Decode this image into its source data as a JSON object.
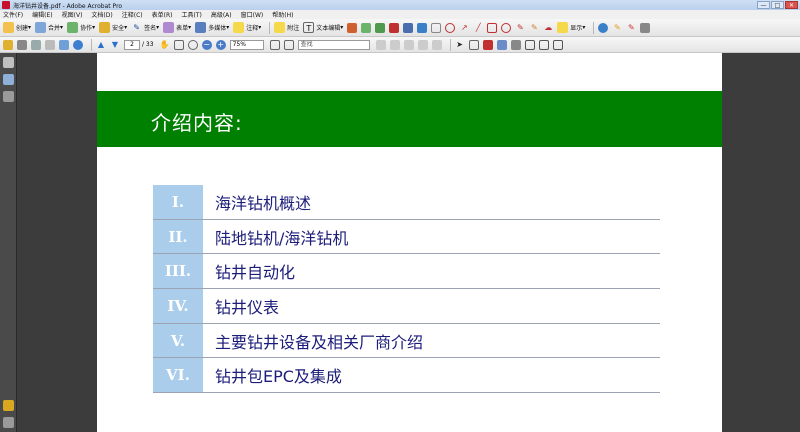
{
  "window": {
    "title": "海洋钻井设备.pdf - Adobe Acrobat Pro",
    "min": "—",
    "max": "□",
    "close": "✕"
  },
  "menu": [
    "文件(F)",
    "编辑(E)",
    "视图(V)",
    "文档(D)",
    "注释(C)",
    "表单(R)",
    "工具(T)",
    "高级(A)",
    "窗口(W)",
    "帮助(H)"
  ],
  "toolbar1": {
    "create": "创建",
    "combine": "合并",
    "collaborate": "协作",
    "secure": "安全",
    "sign": "签名",
    "forms": "表单",
    "multimedia": "多媒体",
    "comment": "注释",
    "note": "附注",
    "text_edit": "文本编辑",
    "show": "显示"
  },
  "toolbar2": {
    "page_current": "2",
    "page_total": "/ 33",
    "zoom": "75%",
    "find_placeholder": "查找"
  },
  "slide": {
    "banner_title": "介绍内容:",
    "items": [
      {
        "num": "I.",
        "text": "海洋钻机概述"
      },
      {
        "num": "II.",
        "text": "陆地钻机/海洋钻机"
      },
      {
        "num": "III.",
        "text": "钻井自动化"
      },
      {
        "num": "IV.",
        "text": "钻井仪表"
      },
      {
        "num": "V.",
        "text": "主要钻井设备及相关厂商介绍"
      },
      {
        "num": "VI.",
        "text": "钻井包EPC及集成"
      }
    ]
  },
  "colors": {
    "banner": "#008000",
    "num_bg": "#abcdec",
    "item_text": "#1c1c7a"
  }
}
